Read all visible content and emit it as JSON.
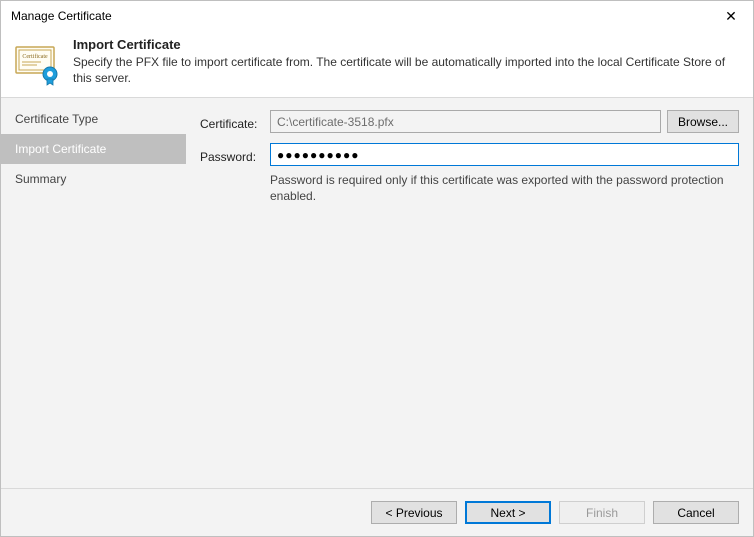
{
  "window": {
    "title": "Manage Certificate",
    "close_icon": "✕"
  },
  "banner": {
    "title": "Import Certificate",
    "description": "Specify the PFX file to import certificate from. The certificate will be automatically imported into the local Certificate Store of this server."
  },
  "sidebar": {
    "steps": [
      {
        "label": "Certificate Type",
        "active": false
      },
      {
        "label": "Import Certificate",
        "active": true
      },
      {
        "label": "Summary",
        "active": false
      }
    ]
  },
  "form": {
    "certificate_label": "Certificate:",
    "certificate_value": "C:\\certificate-3518.pfx",
    "browse_label": "Browse...",
    "password_label": "Password:",
    "password_value": "●●●●●●●●●●",
    "password_hint": "Password is required only if this certificate was exported with the password protection enabled."
  },
  "footer": {
    "previous_label": "< Previous",
    "next_label": "Next >",
    "finish_label": "Finish",
    "cancel_label": "Cancel"
  }
}
